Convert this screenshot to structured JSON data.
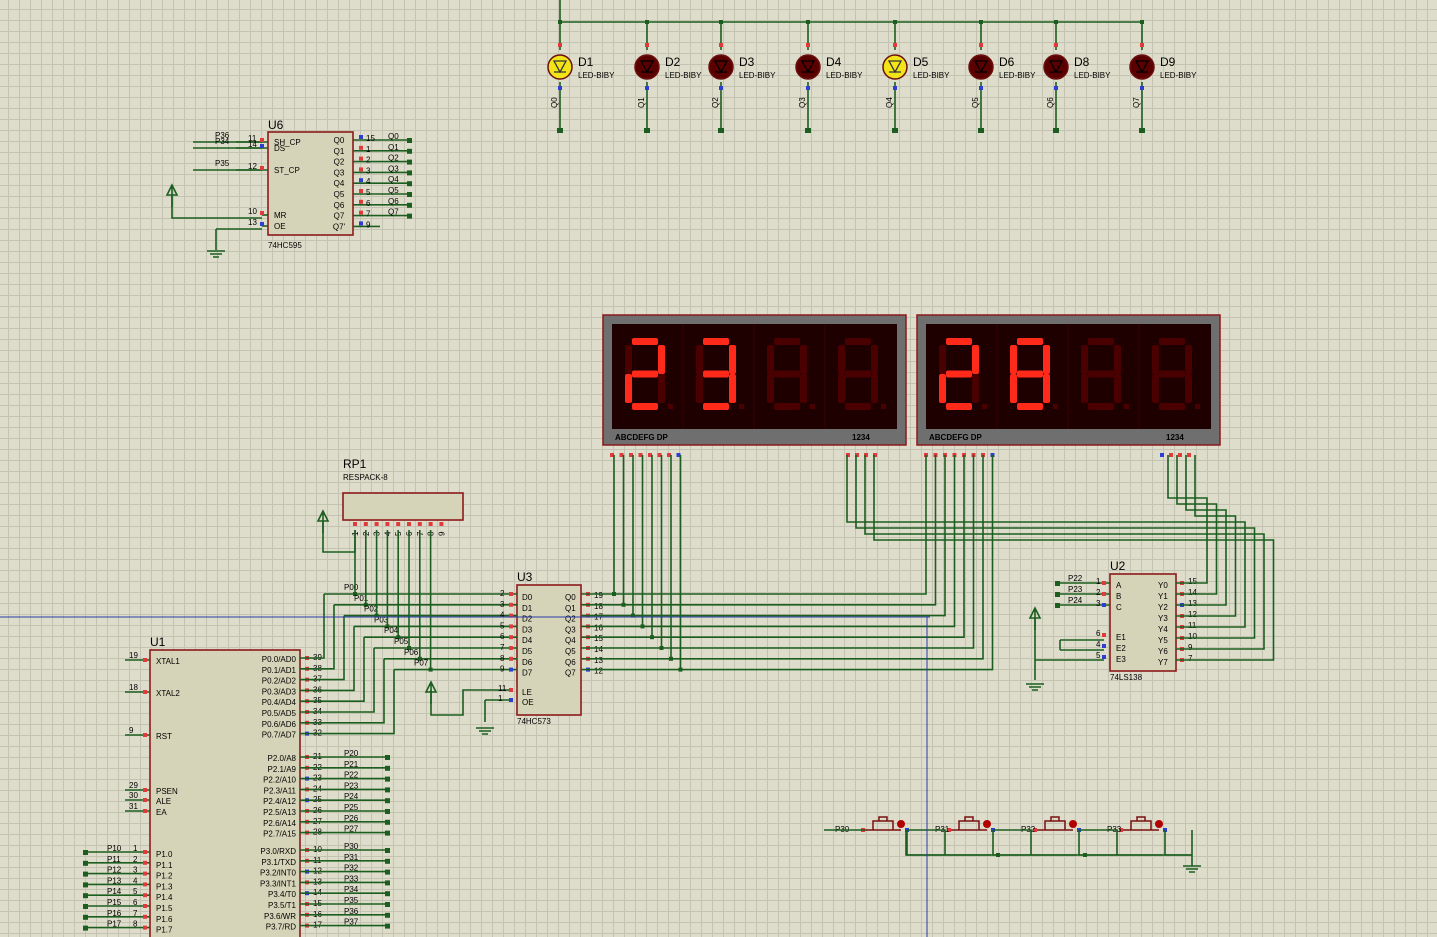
{
  "leds": [
    {
      "ref": "D1",
      "type": "LED-BIBY",
      "net": "Q0",
      "lit": true
    },
    {
      "ref": "D2",
      "type": "LED-BIBY",
      "net": "Q1",
      "lit": false
    },
    {
      "ref": "D3",
      "type": "LED-BIBY",
      "net": "Q2",
      "lit": false
    },
    {
      "ref": "D4",
      "type": "LED-BIBY",
      "net": "Q3",
      "lit": false
    },
    {
      "ref": "D5",
      "type": "LED-BIBY",
      "net": "Q4",
      "lit": true
    },
    {
      "ref": "D6",
      "type": "LED-BIBY",
      "net": "Q5",
      "lit": false
    },
    {
      "ref": "D8",
      "type": "LED-BIBY",
      "net": "Q6",
      "lit": false
    },
    {
      "ref": "D9",
      "type": "LED-BIBY",
      "net": "Q7",
      "lit": false
    }
  ],
  "u6": {
    "ref": "U6",
    "type": "74HC595",
    "left_pins": [
      {
        "num": "11",
        "name": "SH_CP",
        "net": "P36"
      },
      {
        "num": "14",
        "name": "DS",
        "net": "P34"
      },
      {
        "num": "12",
        "name": "ST_CP",
        "net": "P35"
      },
      {
        "num": "10",
        "name": "MR",
        "net": ""
      },
      {
        "num": "13",
        "name": "OE",
        "net": ""
      }
    ],
    "right_pins": [
      {
        "num": "15",
        "name": "Q0",
        "net": "Q0"
      },
      {
        "num": "1",
        "name": "Q1",
        "net": "Q1"
      },
      {
        "num": "2",
        "name": "Q2",
        "net": "Q2"
      },
      {
        "num": "3",
        "name": "Q3",
        "net": "Q3"
      },
      {
        "num": "4",
        "name": "Q4",
        "net": "Q4"
      },
      {
        "num": "5",
        "name": "Q5",
        "net": "Q5"
      },
      {
        "num": "6",
        "name": "Q6",
        "net": "Q6"
      },
      {
        "num": "7",
        "name": "Q7",
        "net": "Q7"
      },
      {
        "num": "9",
        "name": "Q7'",
        "net": ""
      }
    ]
  },
  "displays": [
    {
      "digits": [
        "2",
        "3",
        "8",
        "8"
      ],
      "lit": [
        true,
        true,
        false,
        false
      ],
      "seg_label": "ABCDEFG  DP",
      "dig_label": "1234"
    },
    {
      "digits": [
        "2",
        "8",
        "8",
        "8"
      ],
      "lit": [
        true,
        true,
        false,
        false
      ],
      "seg_label": "ABCDEFG  DP",
      "dig_label": "1234"
    }
  ],
  "rp1": {
    "ref": "RP1",
    "type": "RESPACK-8",
    "pins": [
      "1",
      "2",
      "3",
      "4",
      "5",
      "6",
      "7",
      "8",
      "9"
    ]
  },
  "u3": {
    "ref": "U3",
    "type": "74HC573",
    "d_pins": [
      {
        "num": "2",
        "name": "D0",
        "net": "P00"
      },
      {
        "num": "3",
        "name": "D1",
        "net": "P01"
      },
      {
        "num": "4",
        "name": "D2",
        "net": "P02"
      },
      {
        "num": "5",
        "name": "D3",
        "net": "P03"
      },
      {
        "num": "6",
        "name": "D4",
        "net": "P04"
      },
      {
        "num": "7",
        "name": "D5",
        "net": "P05"
      },
      {
        "num": "8",
        "name": "D6",
        "net": "P06"
      },
      {
        "num": "9",
        "name": "D7",
        "net": "P07"
      }
    ],
    "ctrl_pins": [
      {
        "num": "11",
        "name": "LE"
      },
      {
        "num": "1",
        "name": "OE"
      }
    ],
    "q_pins": [
      {
        "num": "19",
        "name": "Q0"
      },
      {
        "num": "18",
        "name": "Q1"
      },
      {
        "num": "17",
        "name": "Q2"
      },
      {
        "num": "16",
        "name": "Q3"
      },
      {
        "num": "15",
        "name": "Q4"
      },
      {
        "num": "14",
        "name": "Q5"
      },
      {
        "num": "13",
        "name": "Q6"
      },
      {
        "num": "12",
        "name": "Q7"
      }
    ]
  },
  "u2": {
    "ref": "U2",
    "type": "74LS138",
    "in_pins": [
      {
        "num": "1",
        "name": "A",
        "net": "P22"
      },
      {
        "num": "2",
        "name": "B",
        "net": "P23"
      },
      {
        "num": "3",
        "name": "C",
        "net": "P24"
      }
    ],
    "en_pins": [
      {
        "num": "6",
        "name": "E1"
      },
      {
        "num": "4",
        "name": "E2"
      },
      {
        "num": "5",
        "name": "E3"
      }
    ],
    "out_pins": [
      {
        "num": "15",
        "name": "Y0"
      },
      {
        "num": "14",
        "name": "Y1"
      },
      {
        "num": "13",
        "name": "Y2"
      },
      {
        "num": "12",
        "name": "Y3"
      },
      {
        "num": "11",
        "name": "Y4"
      },
      {
        "num": "10",
        "name": "Y5"
      },
      {
        "num": "9",
        "name": "Y6"
      },
      {
        "num": "7",
        "name": "Y7"
      }
    ]
  },
  "u1": {
    "ref": "U1",
    "left_top": [
      {
        "num": "19",
        "name": "XTAL1"
      },
      {
        "num": "18",
        "name": "XTAL2"
      },
      {
        "num": "9",
        "name": "RST"
      },
      {
        "num": "29",
        "name": "PSEN"
      },
      {
        "num": "30",
        "name": "ALE"
      },
      {
        "num": "31",
        "name": "EA"
      }
    ],
    "port1": [
      {
        "num": "1",
        "name": "P1.0",
        "net": "P10"
      },
      {
        "num": "2",
        "name": "P1.1",
        "net": "P11"
      },
      {
        "num": "3",
        "name": "P1.2",
        "net": "P12"
      },
      {
        "num": "4",
        "name": "P1.3",
        "net": "P13"
      },
      {
        "num": "5",
        "name": "P1.4",
        "net": "P14"
      },
      {
        "num": "6",
        "name": "P1.5",
        "net": "P15"
      },
      {
        "num": "7",
        "name": "P1.6",
        "net": "P16"
      },
      {
        "num": "8",
        "name": "P1.7",
        "net": "P17"
      }
    ],
    "port0": [
      {
        "num": "39",
        "name": "P0.0/AD0",
        "net": "P00"
      },
      {
        "num": "38",
        "name": "P0.1/AD1",
        "net": "P01"
      },
      {
        "num": "37",
        "name": "P0.2/AD2",
        "net": "P02"
      },
      {
        "num": "36",
        "name": "P0.3/AD3",
        "net": "P03"
      },
      {
        "num": "35",
        "name": "P0.4/AD4",
        "net": "P04"
      },
      {
        "num": "34",
        "name": "P0.5/AD5",
        "net": "P05"
      },
      {
        "num": "33",
        "name": "P0.6/AD6",
        "net": "P06"
      },
      {
        "num": "32",
        "name": "P0.7/AD7",
        "net": "P07"
      }
    ],
    "port2": [
      {
        "num": "21",
        "name": "P2.0/A8",
        "net": "P20"
      },
      {
        "num": "22",
        "name": "P2.1/A9",
        "net": "P21"
      },
      {
        "num": "23",
        "name": "P2.2/A10",
        "net": "P22"
      },
      {
        "num": "24",
        "name": "P2.3/A11",
        "net": "P23"
      },
      {
        "num": "25",
        "name": "P2.4/A12",
        "net": "P24"
      },
      {
        "num": "26",
        "name": "P2.5/A13",
        "net": "P25"
      },
      {
        "num": "27",
        "name": "P2.6/A14",
        "net": "P26"
      },
      {
        "num": "28",
        "name": "P2.7/A15",
        "net": "P27"
      }
    ],
    "port3": [
      {
        "num": "10",
        "name": "P3.0/RXD",
        "net": "P30"
      },
      {
        "num": "11",
        "name": "P3.1/TXD",
        "net": "P31"
      },
      {
        "num": "12",
        "name": "P3.2/INT0",
        "net": "P32"
      },
      {
        "num": "13",
        "name": "P3.3/INT1",
        "net": "P33"
      },
      {
        "num": "14",
        "name": "P3.4/T0",
        "net": "P34"
      },
      {
        "num": "15",
        "name": "P3.5/T1",
        "net": "P35"
      },
      {
        "num": "16",
        "name": "P3.6/WR",
        "net": "P36"
      },
      {
        "num": "17",
        "name": "P3.7/RD",
        "net": "P37"
      }
    ]
  },
  "buttons": [
    {
      "net": "P30"
    },
    {
      "net": "P31"
    },
    {
      "net": "P32"
    },
    {
      "net": "P33"
    }
  ]
}
